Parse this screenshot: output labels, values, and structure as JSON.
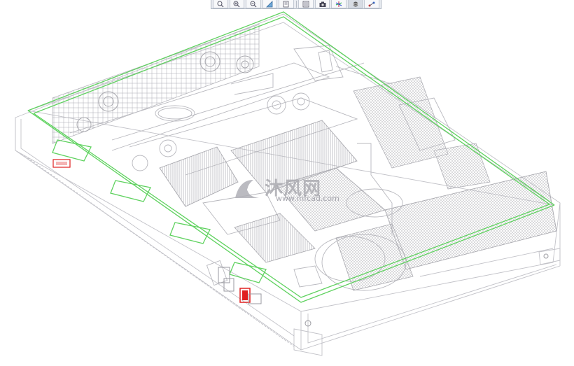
{
  "toolbar": {
    "buttons": [
      {
        "icon": "zoom-fit-icon"
      },
      {
        "icon": "zoom-in-icon"
      },
      {
        "icon": "zoom-out-icon"
      },
      {
        "icon": "view-orient-icon"
      },
      {
        "icon": "saved-views-icon"
      },
      {
        "icon": "layers-icon"
      },
      {
        "icon": "camera-icon"
      },
      {
        "icon": "spin-center-icon"
      },
      {
        "icon": "display-style-icon"
      },
      {
        "icon": "datum-display-icon"
      }
    ],
    "active_index": 8
  },
  "watermark": {
    "title": "沐风网",
    "url": "www.mfcad.com"
  },
  "colors": {
    "background": "#ffffff",
    "model_lines": "#b6b6bc",
    "highlight_edges": "#5fd25f",
    "red_part": "#e02020"
  }
}
